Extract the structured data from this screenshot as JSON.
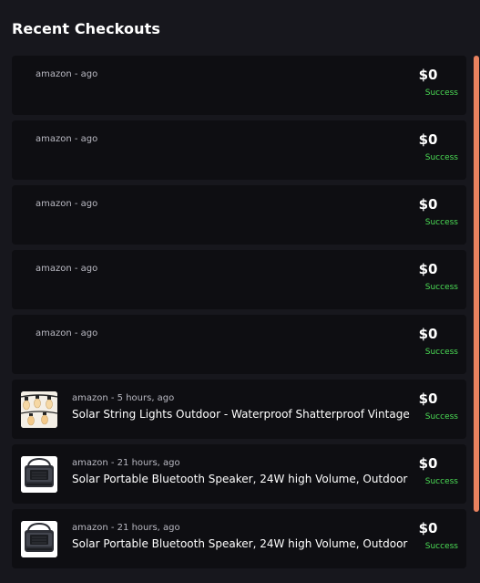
{
  "header": {
    "title": "Recent Checkouts"
  },
  "checkouts": [
    {
      "meta": "amazon - ago",
      "product": "",
      "price": "$0",
      "status": "Success",
      "thumbnail": "none"
    },
    {
      "meta": "amazon - ago",
      "product": "",
      "price": "$0",
      "status": "Success",
      "thumbnail": "none"
    },
    {
      "meta": "amazon - ago",
      "product": "",
      "price": "$0",
      "status": "Success",
      "thumbnail": "none"
    },
    {
      "meta": "amazon - ago",
      "product": "",
      "price": "$0",
      "status": "Success",
      "thumbnail": "none"
    },
    {
      "meta": "amazon - ago",
      "product": "",
      "price": "$0",
      "status": "Success",
      "thumbnail": "none"
    },
    {
      "meta": "amazon - 5 hours, ago",
      "product": "Solar String Lights Outdoor - Waterproof Shatterproof Vintage",
      "price": "$0",
      "status": "Success",
      "thumbnail": "string-lights-image"
    },
    {
      "meta": "amazon - 21 hours, ago",
      "product": "Solar Portable Bluetooth Speaker, 24W high Volume, Outdoor",
      "price": "$0",
      "status": "Success",
      "thumbnail": "speaker-image"
    },
    {
      "meta": "amazon - 21 hours, ago",
      "product": "Solar Portable Bluetooth Speaker, 24W high Volume, Outdoor",
      "price": "$0",
      "status": "Success",
      "thumbnail": "speaker-image"
    }
  ],
  "colors": {
    "background": "#17171d",
    "card": "#0e0e12",
    "success": "#4bdc55",
    "scrollbar": "#e9825f"
  }
}
